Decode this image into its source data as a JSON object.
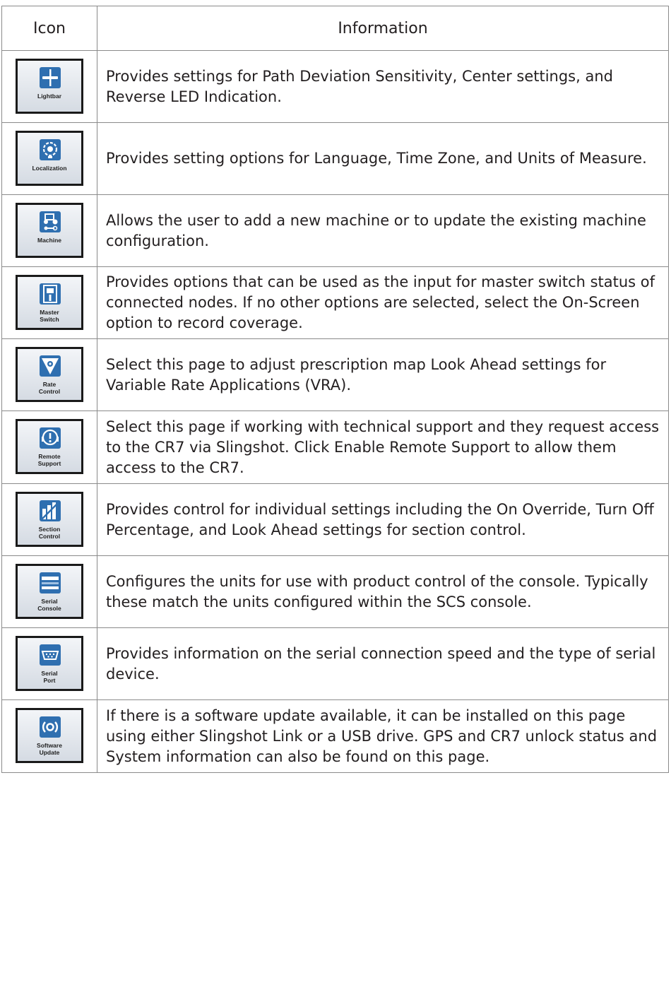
{
  "table": {
    "header": {
      "icon": "Icon",
      "information": "Information"
    },
    "rows": [
      {
        "icon_name": "lightbar-icon",
        "icon_label": "Lightbar",
        "info": "Provides settings for Path Deviation Sensitivity, Center settings, and Reverse LED Indication."
      },
      {
        "icon_name": "localization-icon",
        "icon_label": "Localization",
        "info": "Provides setting options for Language, Time Zone, and Units of Measure."
      },
      {
        "icon_name": "machine-icon",
        "icon_label": "Machine",
        "info": "Allows the user to add a new machine or to update the existing machine configuration."
      },
      {
        "icon_name": "master-switch-icon",
        "icon_label": "Master\nSwitch",
        "info": "Provides options that can be used as the input for master switch status of connected nodes. If no other options are selected, select the On-Screen option to record coverage."
      },
      {
        "icon_name": "rate-control-icon",
        "icon_label": "Rate\nControl",
        "info": "Select this page to adjust prescription map Look Ahead settings for Variable Rate Applications (VRA)."
      },
      {
        "icon_name": "remote-support-icon",
        "icon_label": "Remote\nSupport",
        "info": "Select this page if working with technical support and they request access to the CR7 via Slingshot. Click Enable Remote Support to allow them access to the CR7."
      },
      {
        "icon_name": "section-control-icon",
        "icon_label": "Section\nControl",
        "info": "Provides control for individual settings including the On Override, Turn Off Percentage, and Look Ahead settings for section control."
      },
      {
        "icon_name": "serial-console-icon",
        "icon_label": "Serial\nConsole",
        "info": "Configures the units for use with product control of the console. Typically these match the units configured within the SCS console."
      },
      {
        "icon_name": "serial-port-icon",
        "icon_label": "Serial\nPort",
        "info": "Provides information on the serial connection speed and the type of serial device."
      },
      {
        "icon_name": "software-update-icon",
        "icon_label": "Software\nUpdate",
        "info": "If there is a software update available, it can be installed on this page using either Slingshot Link or a USB drive. GPS and CR7 unlock status and System information can also be found on this page."
      }
    ]
  },
  "colors": {
    "icon_blue": "#2f6fb0",
    "border": "#8a8a8a",
    "text": "#231f20"
  }
}
